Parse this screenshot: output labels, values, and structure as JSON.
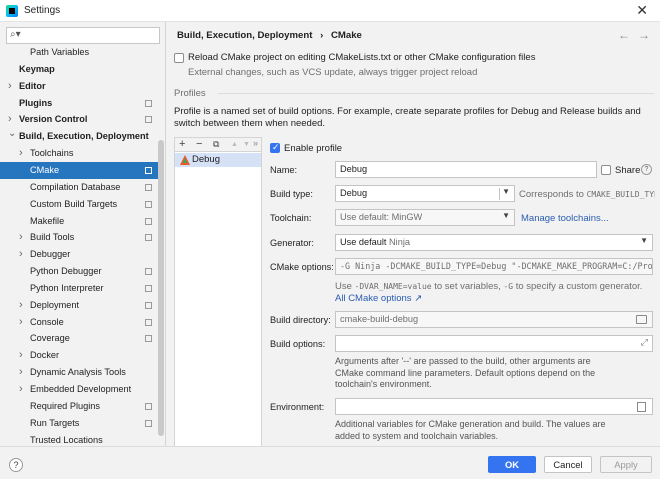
{
  "window": {
    "title": "Settings"
  },
  "search": {
    "placeholder": ""
  },
  "tree": [
    {
      "label": "Path Variables",
      "indent": 30,
      "arrow": false,
      "bold": false,
      "page": false,
      "selected": false
    },
    {
      "label": "Keymap",
      "indent": 19,
      "arrow": false,
      "bold": true,
      "page": false,
      "selected": false
    },
    {
      "label": "Editor",
      "indent": 19,
      "arrow": true,
      "bold": true,
      "page": false,
      "selected": false
    },
    {
      "label": "Plugins",
      "indent": 19,
      "arrow": false,
      "bold": true,
      "page": true,
      "selected": false
    },
    {
      "label": "Version Control",
      "indent": 19,
      "arrow": true,
      "bold": true,
      "page": true,
      "selected": false
    },
    {
      "label": "Build, Execution, Deployment",
      "indent": 19,
      "arrow": true,
      "arrowDown": true,
      "bold": true,
      "page": false,
      "selected": false
    },
    {
      "label": "Toolchains",
      "indent": 30,
      "arrow": true,
      "bold": false,
      "page": false,
      "selected": false
    },
    {
      "label": "CMake",
      "indent": 30,
      "arrow": false,
      "bold": false,
      "page": true,
      "selected": true
    },
    {
      "label": "Compilation Database",
      "indent": 30,
      "arrow": false,
      "bold": false,
      "page": true,
      "selected": false
    },
    {
      "label": "Custom Build Targets",
      "indent": 30,
      "arrow": false,
      "bold": false,
      "page": true,
      "selected": false
    },
    {
      "label": "Makefile",
      "indent": 30,
      "arrow": false,
      "bold": false,
      "page": true,
      "selected": false
    },
    {
      "label": "Build Tools",
      "indent": 30,
      "arrow": true,
      "bold": false,
      "page": true,
      "selected": false
    },
    {
      "label": "Debugger",
      "indent": 30,
      "arrow": true,
      "bold": false,
      "page": false,
      "selected": false
    },
    {
      "label": "Python Debugger",
      "indent": 30,
      "arrow": false,
      "bold": false,
      "page": true,
      "selected": false
    },
    {
      "label": "Python Interpreter",
      "indent": 30,
      "arrow": false,
      "bold": false,
      "page": true,
      "selected": false
    },
    {
      "label": "Deployment",
      "indent": 30,
      "arrow": true,
      "bold": false,
      "page": true,
      "selected": false
    },
    {
      "label": "Console",
      "indent": 30,
      "arrow": true,
      "bold": false,
      "page": true,
      "selected": false
    },
    {
      "label": "Coverage",
      "indent": 30,
      "arrow": false,
      "bold": false,
      "page": true,
      "selected": false
    },
    {
      "label": "Docker",
      "indent": 30,
      "arrow": true,
      "bold": false,
      "page": false,
      "selected": false
    },
    {
      "label": "Dynamic Analysis Tools",
      "indent": 30,
      "arrow": true,
      "bold": false,
      "page": false,
      "selected": false
    },
    {
      "label": "Embedded Development",
      "indent": 30,
      "arrow": true,
      "bold": false,
      "page": false,
      "selected": false
    },
    {
      "label": "Required Plugins",
      "indent": 30,
      "arrow": false,
      "bold": false,
      "page": true,
      "selected": false
    },
    {
      "label": "Run Targets",
      "indent": 30,
      "arrow": false,
      "bold": false,
      "page": true,
      "selected": false
    },
    {
      "label": "Trusted Locations",
      "indent": 30,
      "arrow": false,
      "bold": false,
      "page": false,
      "selected": false
    }
  ],
  "breadcrumb": {
    "parent": "Build, Execution, Deployment",
    "separator": "›",
    "current": "CMake"
  },
  "nav": {
    "back": "←",
    "forward": "→"
  },
  "reload": {
    "label": "Reload CMake project on editing CMakeLists.txt or other CMake configuration files",
    "hint": "External changes, such as VCS update, always trigger project reload"
  },
  "profiles": {
    "section": "Profiles",
    "description": "Profile is a named set of build options. For example, create separate profiles for Debug and Release builds and switch between them when needed.",
    "toolbar": {
      "add": "+",
      "remove": "−",
      "copy": "⧉",
      "up": "▲",
      "down": "▼",
      "more": "»"
    },
    "items": [
      {
        "name": "Debug"
      }
    ]
  },
  "form": {
    "enable_profile": "Enable profile",
    "name_label": "Name:",
    "name_value": "Debug",
    "share_label": "Share",
    "build_type_label": "Build type:",
    "build_type_value": "Debug",
    "build_type_hint": "Corresponds to ",
    "build_type_hint_code": "CMAKE_BUILD_TYPE",
    "toolchain_label": "Toolchain:",
    "toolchain_value": "Use default: MinGW",
    "manage_toolchains": "Manage toolchains...",
    "generator_label": "Generator:",
    "generator_value": "Use default",
    "generator_hint": "Ninja",
    "cmake_options_label": "CMake options:",
    "cmake_options_value": "-G Ninja -DCMAKE_BUILD_TYPE=Debug \"-DCMAKE_MAKE_PROGRAM=C:/Progra",
    "cmake_options_hint_a": "Use ",
    "cmake_options_hint_code1": "-DVAR_NAME=value",
    "cmake_options_hint_b": " to set variables, ",
    "cmake_options_hint_code2": "-G",
    "cmake_options_hint_c": " to specify a custom generator.",
    "all_cmake_options": "All CMake options ↗",
    "build_dir_label": "Build directory:",
    "build_dir_value": "cmake-build-debug",
    "build_options_label": "Build options:",
    "build_options_value": "",
    "build_options_hint": "Arguments after '--' are passed to the build, other arguments are CMake command line parameters. Default options depend on the toolchain's environment.",
    "environment_label": "Environment:",
    "environment_value": "",
    "environment_hint": "Additional variables for CMake generation and build. The values are added to system and toolchain variables."
  },
  "buttons": {
    "help": "?",
    "ok": "OK",
    "cancel": "Cancel",
    "apply": "Apply"
  },
  "colors": {
    "accent": "#3574f0",
    "selection": "#2675bf",
    "link": "#2a5db0"
  }
}
